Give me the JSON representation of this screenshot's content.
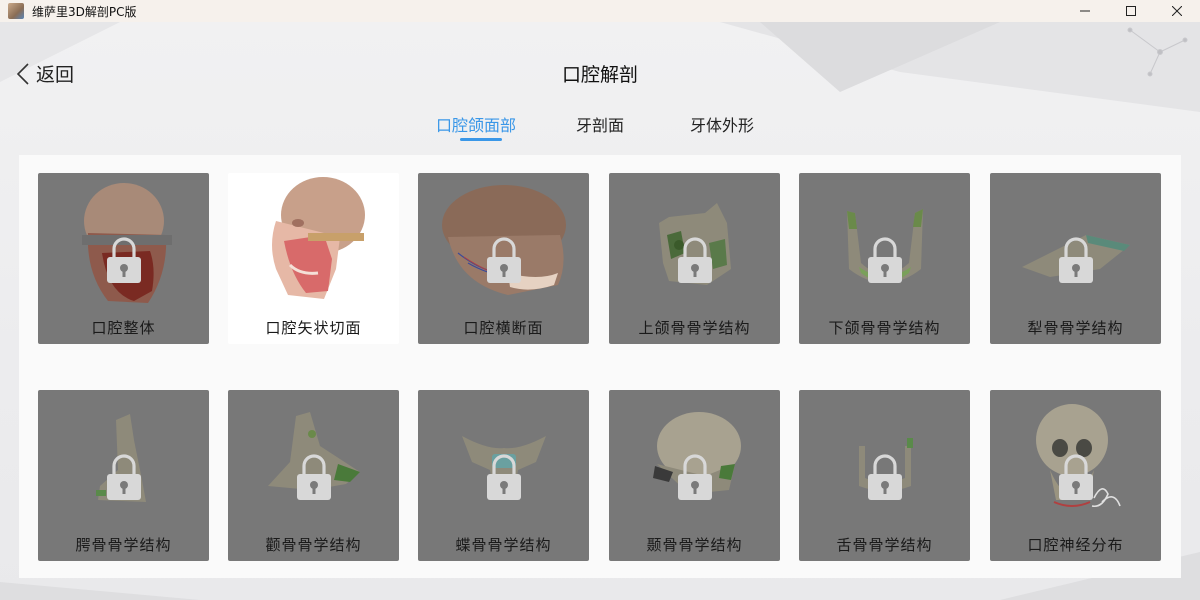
{
  "window": {
    "title": "维萨里3D解剖PC版",
    "minimize_glyph": "—",
    "maximize_glyph": "☐",
    "close_glyph": "✕"
  },
  "header": {
    "back_label": "返回",
    "title": "口腔解剖"
  },
  "tabs": [
    {
      "label": "口腔颌面部",
      "active": true
    },
    {
      "label": "牙剖面",
      "active": false
    },
    {
      "label": "牙体外形",
      "active": false
    }
  ],
  "colors": {
    "accent": "#3a97e8",
    "card_locked": "#787878",
    "card_unlocked": "#ffffff"
  },
  "items": [
    {
      "label": "口腔整体",
      "locked": true,
      "icon": "head-muscles-model"
    },
    {
      "label": "口腔矢状切面",
      "locked": false,
      "icon": "sagittal-head-model"
    },
    {
      "label": "口腔横断面",
      "locked": true,
      "icon": "head-cross-section-model"
    },
    {
      "label": "上颌骨骨学结构",
      "locked": true,
      "icon": "maxilla-bone-model"
    },
    {
      "label": "下颌骨骨学结构",
      "locked": true,
      "icon": "mandible-bone-model"
    },
    {
      "label": "犁骨骨学结构",
      "locked": true,
      "icon": "vomer-bone-model"
    },
    {
      "label": "腭骨骨学结构",
      "locked": true,
      "icon": "palatine-bone-model"
    },
    {
      "label": "颧骨骨学结构",
      "locked": true,
      "icon": "zygomatic-bone-model"
    },
    {
      "label": "蝶骨骨学结构",
      "locked": true,
      "icon": "sphenoid-bone-model"
    },
    {
      "label": "颞骨骨学结构",
      "locked": true,
      "icon": "temporal-bone-model"
    },
    {
      "label": "舌骨骨学结构",
      "locked": true,
      "icon": "hyoid-bone-model"
    },
    {
      "label": "口腔神经分布",
      "locked": true,
      "icon": "skull-nerves-model"
    }
  ]
}
